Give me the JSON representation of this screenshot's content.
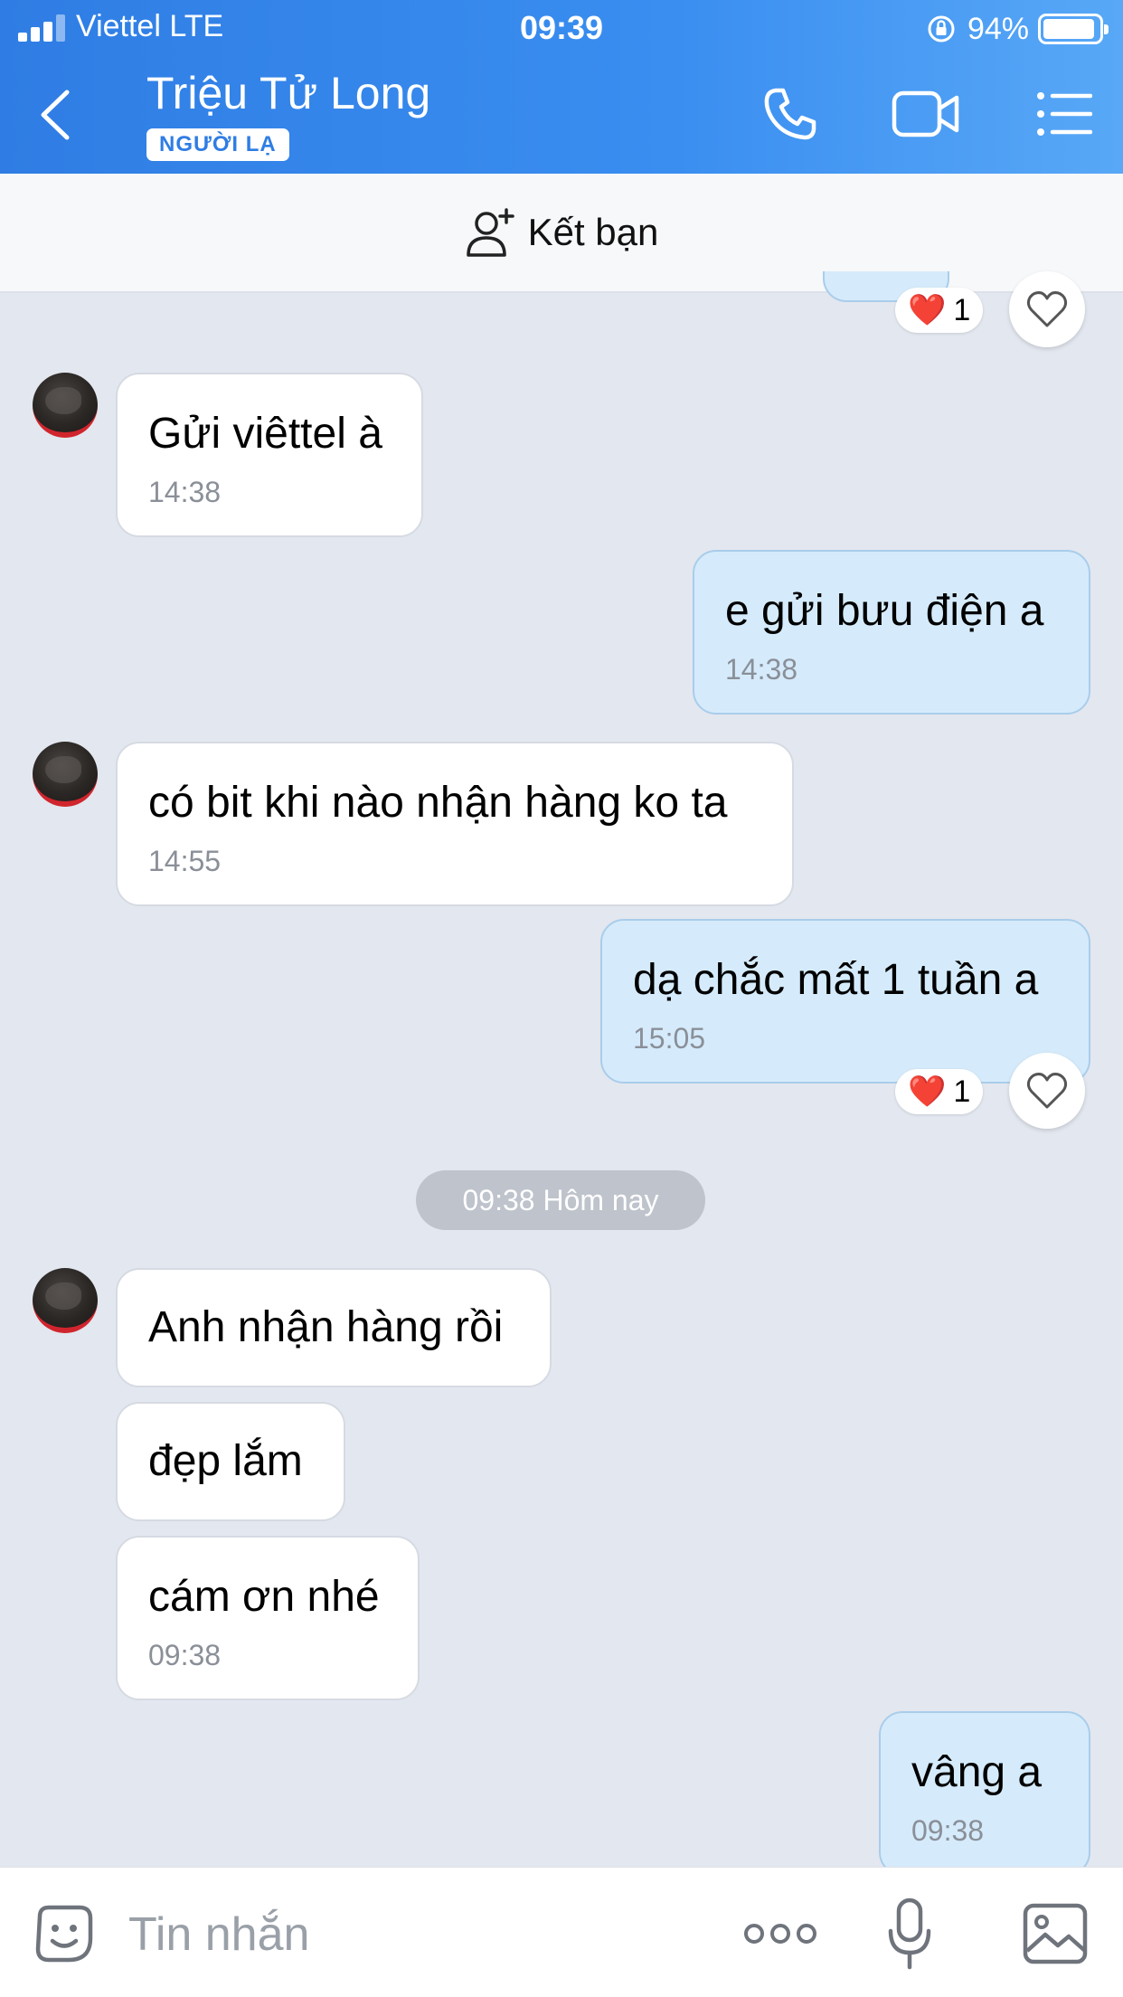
{
  "status_bar": {
    "carrier": "Viettel  LTE",
    "time": "09:39",
    "battery_percent": "94%",
    "battery_level": 0.94
  },
  "header": {
    "contact_name": "Triệu Tử Long",
    "badge": "NGƯỜI LẠ",
    "icons": [
      "back-icon",
      "phone-icon",
      "video-call-icon",
      "menu-icon"
    ],
    "bg_color": "#3a8ef0"
  },
  "friend_bar": {
    "label": "Kết bạn",
    "icon": "add-friend-icon"
  },
  "messages": [
    {
      "side": "in",
      "text": "Gửi viêttel à",
      "time": "14:38"
    },
    {
      "side": "out",
      "text": "e gửi bưu điện a",
      "time": "14:38"
    },
    {
      "side": "in",
      "text": "có bit khi nào nhận hàng ko ta",
      "time": "14:55"
    },
    {
      "side": "out",
      "text": "dạ chắc mất 1 tuần a",
      "time": "15:05"
    },
    {
      "side": "in",
      "text": "Anh nhận hàng rồi",
      "time": ""
    },
    {
      "side": "in",
      "text": "đẹp lắm",
      "time": ""
    },
    {
      "side": "in",
      "text": "cám ơn nhé",
      "time": "09:38"
    },
    {
      "side": "out",
      "text": "vâng a",
      "time": "09:38"
    }
  ],
  "reactions": [
    {
      "emoji": "❤️",
      "count": "1"
    },
    {
      "emoji": "❤️",
      "count": "1"
    }
  ],
  "date_separator": "09:38 Hôm nay",
  "input_bar": {
    "placeholder": "Tin nhắn",
    "icons": [
      "sticker-icon",
      "more-icon",
      "microphone-icon",
      "image-icon"
    ]
  },
  "colors": {
    "outgoing_bubble": "#d5ebfb",
    "incoming_bubble": "#ffffff",
    "chat_background": "#e3e7ef"
  }
}
